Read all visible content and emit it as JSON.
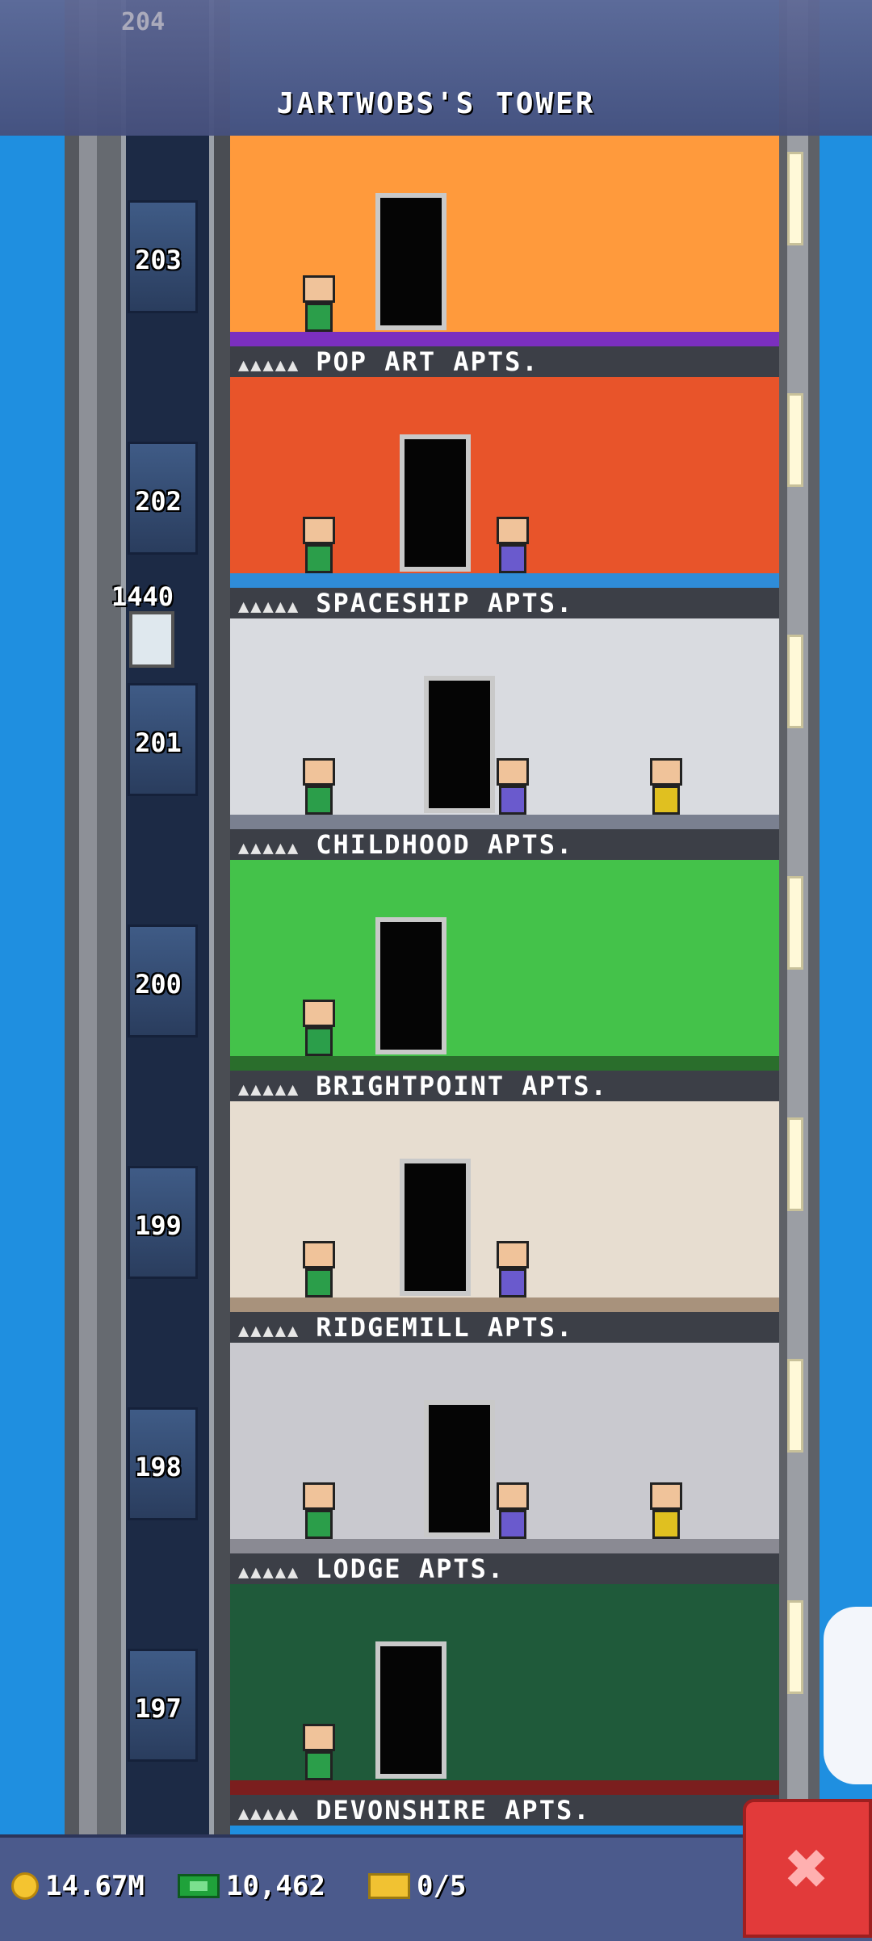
{
  "header": {
    "title": "JARTWOBS'S TOWER",
    "top_floor_number": "204"
  },
  "floors": [
    {
      "number": "203",
      "name": "POP ART APTS.",
      "colors": {
        "wall": "#ff9a3c",
        "accent": "#7b2fbf"
      }
    },
    {
      "number": "202",
      "name": "SPACESHIP APTS.",
      "colors": {
        "wall": "#e8542a",
        "accent": "#2f8cd8"
      }
    },
    {
      "number": "201",
      "name": "CHILDHOOD APTS.",
      "colors": {
        "wall": "#d9dbe0",
        "accent": "#7a8090"
      }
    },
    {
      "number": "200",
      "name": "BRIGHTPOINT APTS.",
      "colors": {
        "wall": "#44c24a",
        "accent": "#2a6e2c"
      }
    },
    {
      "number": "199",
      "name": "RIDGEMILL APTS.",
      "colors": {
        "wall": "#e7ddd0",
        "accent": "#a8927c"
      }
    },
    {
      "number": "198",
      "name": "LODGE APTS.",
      "colors": {
        "wall": "#c9c9cf",
        "accent": "#8a8a93"
      }
    },
    {
      "number": "197",
      "name": "DEVONSHIRE APTS.",
      "colors": {
        "wall": "#1f5a3a",
        "accent": "#7b1e1e"
      }
    }
  ],
  "occupancy_icon": "person-icons",
  "occupancy_marks": "▲▲▲▲▲",
  "elevator": {
    "value": "1440"
  },
  "footer": {
    "coins": "14.67M",
    "bux": "10,462",
    "tickets": "0/5",
    "coin_icon": "coin-icon",
    "bux_icon": "bux-icon",
    "ticket_icon": "ticket-icon"
  },
  "close_label": "✖",
  "colors": {
    "sky": "#1f8fe0",
    "footer": "#4b5a8c",
    "close": "#e23a3a"
  }
}
